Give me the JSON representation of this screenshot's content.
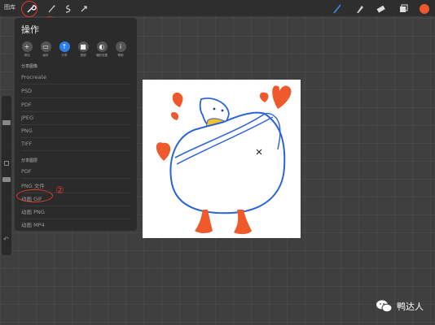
{
  "topbar": {
    "gallery": "图库"
  },
  "panel": {
    "title": "操作",
    "actions": [
      {
        "icon": "add-icon",
        "label": "添加"
      },
      {
        "icon": "canvas-icon",
        "label": "画布"
      },
      {
        "icon": "share-icon",
        "label": "分享"
      },
      {
        "icon": "video-icon",
        "label": "视频"
      },
      {
        "icon": "prefs-icon",
        "label": "偏好设置"
      },
      {
        "icon": "help-icon",
        "label": "帮助"
      }
    ],
    "section_image": "分享图像",
    "image_formats": [
      "Procreate",
      "PSD",
      "PDF",
      "JPEG",
      "PNG",
      "TIFF"
    ],
    "section_layers": "分享图层",
    "layer_formats": [
      "PDF",
      "PNG 文件",
      "动画 GIF",
      "动画 PNG",
      "动画 MP4"
    ]
  },
  "annotations": {
    "one": "①",
    "two": "②"
  },
  "watermark": {
    "text": "鸭达人"
  },
  "colors": {
    "accent": "#2f7de6",
    "annotation": "#e0392f",
    "heart": "#ef5a2c",
    "duck_outline": "#2a63d6"
  }
}
